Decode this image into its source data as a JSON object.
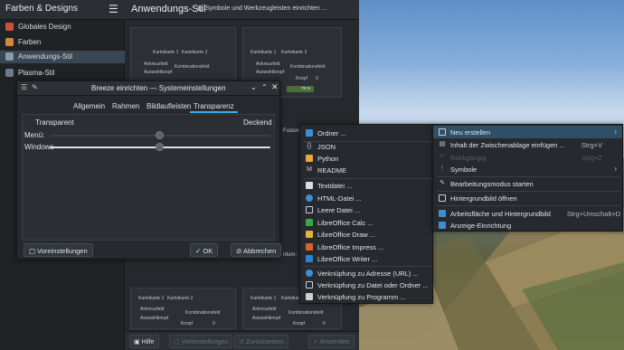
{
  "sidebar": {
    "title": "Farben & Designs",
    "items": [
      {
        "label": "Globales Design",
        "selected": false,
        "color": "#c5523a"
      },
      {
        "label": "Farben",
        "selected": false,
        "color": "#d9863a"
      },
      {
        "label": "Anwendungs-Stil",
        "selected": true,
        "color": "#8a9aa8"
      },
      {
        "label": "Plasma-Stil",
        "selected": false,
        "color": "#6a7b8c"
      }
    ]
  },
  "main": {
    "title": "Anwendungs-Stil",
    "configure_link": "Symbole und Werkzeugleisten einrichten ...",
    "preview_tabs": [
      "Karteikarte 1",
      "Karteikarte 2"
    ],
    "preview_controls": [
      "Ankreuzfeld",
      "Auswahlknopf",
      "Knopf",
      "Kombinationsfeld",
      "0"
    ],
    "preview_progress": "75 %",
    "preview_partial_labels": [
      "Fusion",
      "ntum-"
    ],
    "footer": {
      "help": "Hilfe",
      "defaults": "Voreinstellungen",
      "reset": "Zurücksetzen",
      "apply": "Anwenden"
    }
  },
  "dialog": {
    "title": "Breeze einrichten — Systemeinstellungen",
    "tabs": [
      "Allgemein",
      "Rahmen",
      "Bildlaufleisten",
      "Transparenz"
    ],
    "selected_tab": "Transparenz",
    "transparent_label": "Transparent",
    "opaque_label": "Deckend",
    "menu_label": "Menü:",
    "windows_label": "Windows",
    "menu_value": 0.5,
    "windows_value": 0.5,
    "defaults_button": "Voreinstellungen",
    "ok_button": "OK",
    "cancel_button": "Abbrechen"
  },
  "submenu": {
    "items": [
      {
        "label": "Ordner ...",
        "icon": "folder-icon"
      },
      {
        "label": "JSON",
        "icon": "json-icon"
      },
      {
        "label": "Python",
        "icon": "python-icon"
      },
      {
        "label": "README",
        "icon": "readme-icon"
      },
      {
        "label": "Textdatei ...",
        "icon": "text-file-icon"
      },
      {
        "label": "HTML-Datei ...",
        "icon": "html-file-icon"
      },
      {
        "label": "Leere Datei ...",
        "icon": "empty-file-icon"
      },
      {
        "label": "LibreOffice Calc ...",
        "icon": "libreoffice-calc-icon"
      },
      {
        "label": "LibreOffice Draw ...",
        "icon": "libreoffice-draw-icon"
      },
      {
        "label": "LibreOffice Impress ...",
        "icon": "libreoffice-impress-icon"
      },
      {
        "label": "LibreOffice Writer ...",
        "icon": "libreoffice-writer-icon"
      },
      {
        "label": "Verknüpfung zu Adresse (URL) ...",
        "icon": "link-url-icon"
      },
      {
        "label": "Verknüpfung zu Datei oder Ordner ...",
        "icon": "link-file-icon"
      },
      {
        "label": "Verknüpfung zu Programm ...",
        "icon": "link-program-icon"
      }
    ]
  },
  "context_menu": {
    "items": [
      {
        "label": "Neu erstellen",
        "shortcut": "",
        "submenu": true,
        "highlighted": true,
        "disabled": false
      },
      {
        "label": "Inhalt der Zwischenablage einfügen ...",
        "shortcut": "Strg+V",
        "submenu": false,
        "highlighted": false,
        "disabled": false
      },
      {
        "label": "Rückgängig",
        "shortcut": "Strg+Z",
        "submenu": false,
        "highlighted": false,
        "disabled": true
      },
      {
        "label": "Symbole",
        "shortcut": "",
        "submenu": true,
        "highlighted": false,
        "disabled": false
      },
      {
        "label": "Bearbeitungsmodus starten",
        "shortcut": "",
        "submenu": false,
        "highlighted": false,
        "disabled": false
      },
      {
        "label": "Hintergrundbild öffnen",
        "shortcut": "",
        "submenu": false,
        "highlighted": false,
        "disabled": false
      },
      {
        "label": "Arbeitsfläche und Hintergrundbild",
        "shortcut": "Strg+Umschalt+D",
        "submenu": false,
        "highlighted": false,
        "disabled": false
      },
      {
        "label": "Anzeige-Einrichtung",
        "shortcut": "",
        "submenu": false,
        "highlighted": false,
        "disabled": false
      }
    ]
  }
}
